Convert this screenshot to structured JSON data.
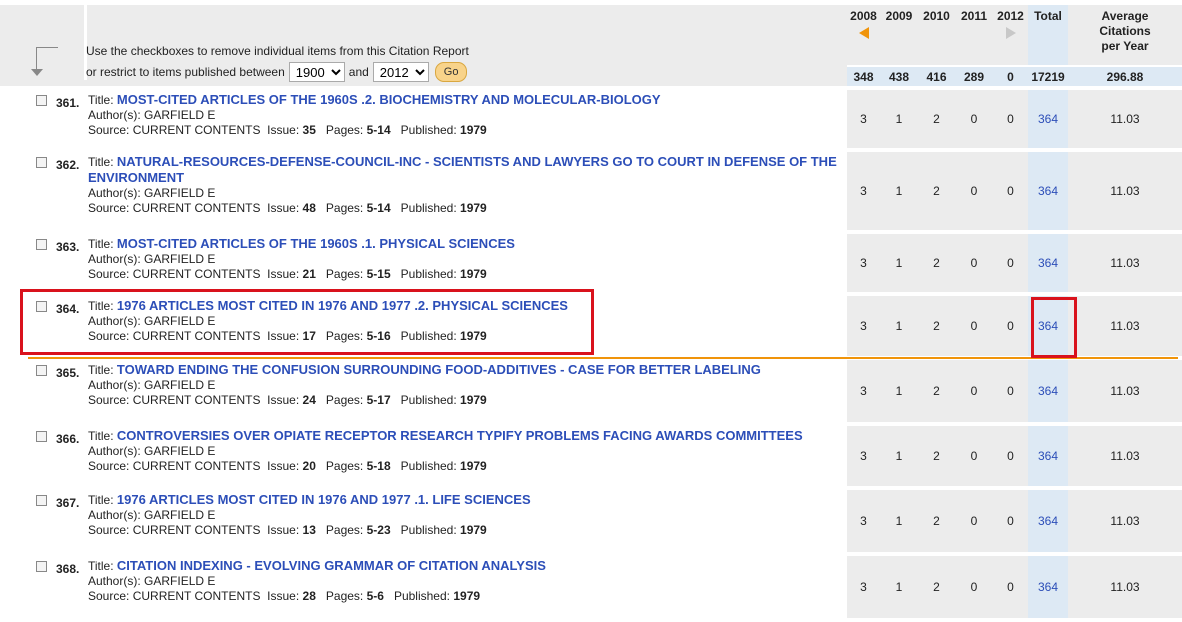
{
  "header": {
    "instruction": "Use the checkboxes to remove individual items from this Citation Report",
    "restrict_prefix": "or restrict to items published between",
    "from_year": "1900",
    "and_label": "and",
    "to_year": "2012",
    "go_label": "Go"
  },
  "columns": {
    "years": [
      "2008",
      "2009",
      "2010",
      "2011",
      "2012"
    ],
    "total_label": "Total",
    "avg_label_1": "Average",
    "avg_label_2": "Citations",
    "avg_label_3": "per Year"
  },
  "summary": {
    "years": [
      "348",
      "438",
      "416",
      "289",
      "0"
    ],
    "total": "17219",
    "avg": "296.88"
  },
  "records": [
    {
      "num": "361.",
      "title": "MOST-CITED ARTICLES OF THE 1960S .2. BIOCHEMISTRY AND MOLECULAR-BIOLOGY",
      "authors": "GARFIELD E",
      "source": "CURRENT CONTENTS",
      "issue": "35",
      "pages": "5-14",
      "published": "1979",
      "counts": [
        "3",
        "1",
        "2",
        "0",
        "0"
      ],
      "total": "364",
      "avg": "11.03"
    },
    {
      "num": "362.",
      "title": "NATURAL-RESOURCES-DEFENSE-COUNCIL-INC - SCIENTISTS AND LAWYERS GO TO COURT IN DEFENSE OF THE ENVIRONMENT",
      "authors": "GARFIELD E",
      "source": "CURRENT CONTENTS",
      "issue": "48",
      "pages": "5-14",
      "published": "1979",
      "counts": [
        "3",
        "1",
        "2",
        "0",
        "0"
      ],
      "total": "364",
      "avg": "11.03"
    },
    {
      "num": "363.",
      "title": "MOST-CITED ARTICLES OF THE 1960S .1. PHYSICAL SCIENCES",
      "authors": "GARFIELD E",
      "source": "CURRENT CONTENTS",
      "issue": "21",
      "pages": "5-15",
      "published": "1979",
      "counts": [
        "3",
        "1",
        "2",
        "0",
        "0"
      ],
      "total": "364",
      "avg": "11.03"
    },
    {
      "num": "364.",
      "title": "1976 ARTICLES MOST CITED IN 1976 AND 1977 .2. PHYSICAL SCIENCES",
      "authors": "GARFIELD E",
      "source": "CURRENT CONTENTS",
      "issue": "17",
      "pages": "5-16",
      "published": "1979",
      "counts": [
        "3",
        "1",
        "2",
        "0",
        "0"
      ],
      "total": "364",
      "avg": "11.03"
    },
    {
      "num": "365.",
      "title": "TOWARD ENDING THE CONFUSION SURROUNDING FOOD-ADDITIVES - CASE FOR BETTER LABELING",
      "authors": "GARFIELD E",
      "source": "CURRENT CONTENTS",
      "issue": "24",
      "pages": "5-17",
      "published": "1979",
      "counts": [
        "3",
        "1",
        "2",
        "0",
        "0"
      ],
      "total": "364",
      "avg": "11.03"
    },
    {
      "num": "366.",
      "title": "CONTROVERSIES OVER OPIATE RECEPTOR RESEARCH TYPIFY PROBLEMS FACING AWARDS COMMITTEES",
      "authors": "GARFIELD E",
      "source": "CURRENT CONTENTS",
      "issue": "20",
      "pages": "5-18",
      "published": "1979",
      "counts": [
        "3",
        "1",
        "2",
        "0",
        "0"
      ],
      "total": "364",
      "avg": "11.03"
    },
    {
      "num": "367.",
      "title": "1976 ARTICLES MOST CITED IN 1976 AND 1977 .1. LIFE SCIENCES",
      "authors": "GARFIELD E",
      "source": "CURRENT CONTENTS",
      "issue": "13",
      "pages": "5-23",
      "published": "1979",
      "counts": [
        "3",
        "1",
        "2",
        "0",
        "0"
      ],
      "total": "364",
      "avg": "11.03"
    },
    {
      "num": "368.",
      "title": "CITATION INDEXING - EVOLVING GRAMMAR OF CITATION ANALYSIS",
      "authors": "GARFIELD E",
      "source": "CURRENT CONTENTS",
      "issue": "28",
      "pages": "5-6",
      "published": "1979",
      "counts": [
        "3",
        "1",
        "2",
        "0",
        "0"
      ],
      "total": "364",
      "avg": "11.03"
    }
  ],
  "labels": {
    "title": "Title:",
    "authors": "Author(s):",
    "source": "Source:",
    "issue": "Issue:",
    "pages": "Pages:",
    "published": "Published:"
  },
  "colors": {
    "link": "#2c4eb8",
    "highlight": "#d9121c",
    "separator": "#f0940a",
    "total_col": "#dde9f4",
    "grey_col": "#ececec"
  }
}
